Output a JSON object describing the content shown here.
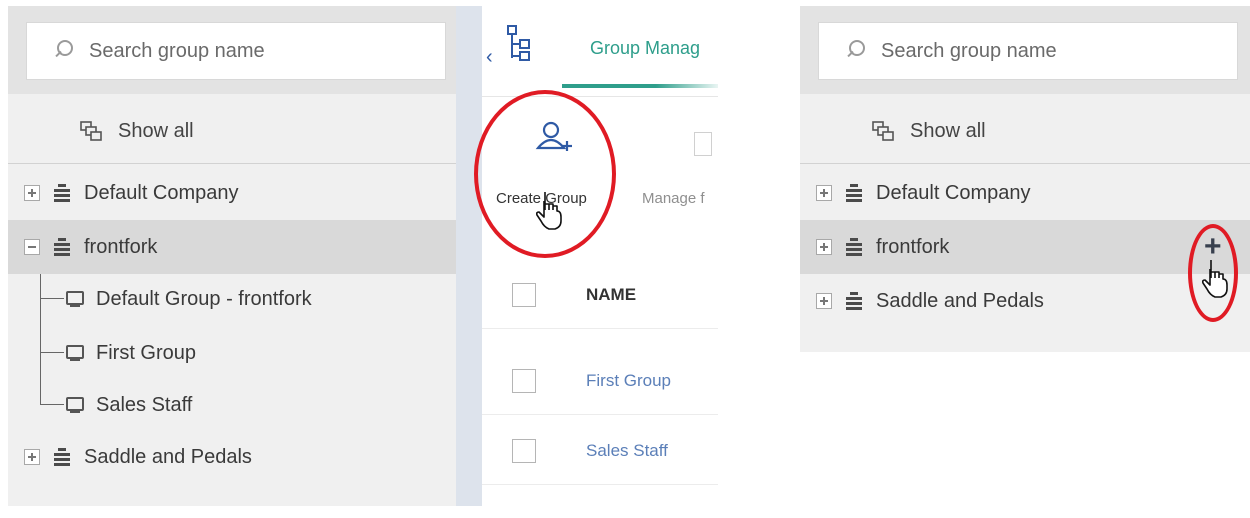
{
  "left_panel": {
    "search": {
      "placeholder": "Search group name"
    },
    "show_all_label": "Show all",
    "tree": {
      "default_company": "Default Company",
      "frontfork": "frontfork",
      "children": [
        "Default Group - frontfork",
        "First Group",
        "Sales Staff"
      ],
      "saddle": "Saddle and Pedals"
    }
  },
  "middle_panel": {
    "tab_label": "Group Manag",
    "create_group_label": "Create Group",
    "manage_label": "Manage f",
    "table": {
      "header_name": "NAME",
      "rows": [
        "First Group",
        "Sales Staff"
      ]
    }
  },
  "right_panel": {
    "search": {
      "placeholder": "Search group name"
    },
    "show_all_label": "Show all",
    "tree": [
      "Default Company",
      "frontfork",
      "Saddle and Pedals"
    ],
    "hover_action": "+"
  },
  "colors": {
    "accent_teal": "#2e9e8b",
    "link_blue": "#5b7fb8",
    "highlight_red": "#e01b24",
    "panel_gray": "#f0f0f0"
  }
}
